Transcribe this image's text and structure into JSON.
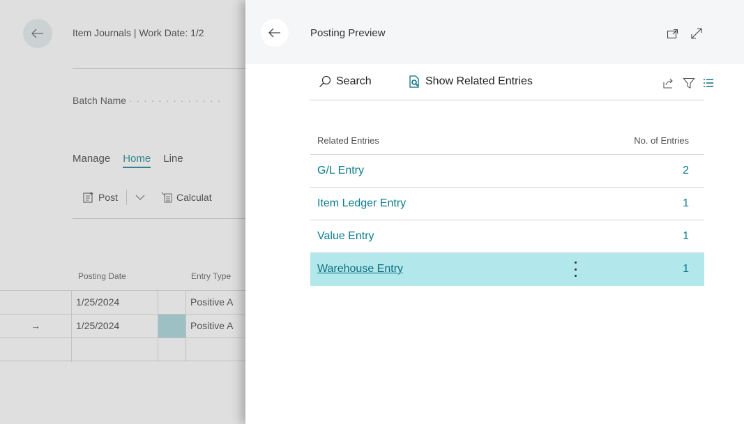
{
  "background": {
    "title": "Item Journals | Work Date: 1/2",
    "batch_label": "Batch Name",
    "batch_dots": "· · · · · · · · · · · · ·",
    "tabs": [
      "Manage",
      "Home",
      "Line"
    ],
    "actions": {
      "post": "Post",
      "calculate": "Calculat"
    },
    "columns": {
      "posting_date": "Posting Date",
      "entry_type": "Entry Type"
    },
    "rows": [
      {
        "indicator": "",
        "date": "1/25/2024",
        "type": "Positive A"
      },
      {
        "indicator": "→",
        "date": "1/25/2024",
        "type": "Positive A"
      },
      {
        "indicator": "",
        "date": "",
        "type": ""
      }
    ]
  },
  "dialog": {
    "title": "Posting Preview",
    "toolbar": {
      "search": "Search",
      "show_related": "Show Related Entries"
    },
    "columns": {
      "related": "Related Entries",
      "count": "No. of Entries"
    },
    "entries": [
      {
        "name": "G/L Entry",
        "count": "2"
      },
      {
        "name": "Item Ledger Entry",
        "count": "1"
      },
      {
        "name": "Value Entry",
        "count": "1"
      },
      {
        "name": "Warehouse Entry",
        "count": "1"
      }
    ]
  },
  "colors": {
    "accent": "#0a7d8c",
    "selected_row": "#b2e8ec"
  }
}
